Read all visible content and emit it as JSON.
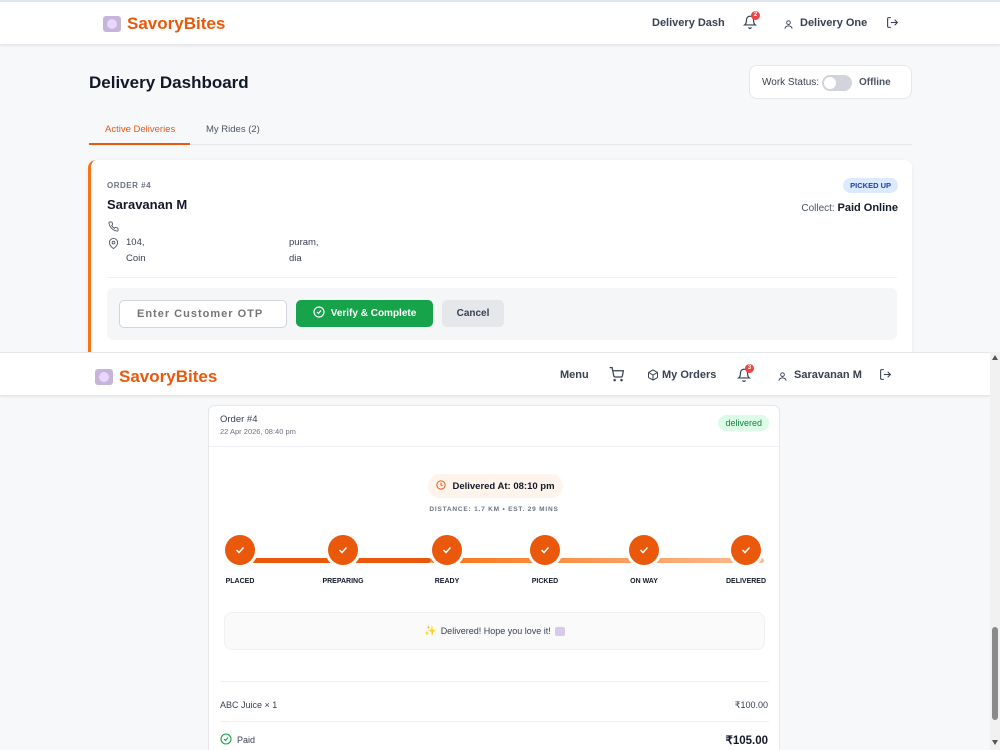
{
  "dashboard": {
    "brand": "SavoryBites",
    "nav": {
      "link": "Delivery Dash",
      "notification_count": "2",
      "user": "Delivery One"
    },
    "title": "Delivery Dashboard",
    "work_status": {
      "label": "Work Status:",
      "value": "Offline"
    },
    "tabs": [
      {
        "label": "Active Deliveries",
        "active": true
      },
      {
        "label": "My Rides (2)",
        "active": false
      }
    ],
    "order": {
      "label": "ORDER #4",
      "customer": "Saravanan M",
      "address_line1_a": "104,",
      "address_line1_b": "puram,",
      "address_line2_a": "Coin",
      "address_line2_b": "dia",
      "status": "PICKED UP",
      "collect_label": "Collect:",
      "collect_value": "Paid Online",
      "otp_placeholder": "Enter Customer OTP",
      "verify_label": "Verify & Complete",
      "cancel_label": "Cancel"
    }
  },
  "customer": {
    "brand": "SavoryBites",
    "nav": {
      "menu": "Menu",
      "orders": "My Orders",
      "notification_count": "3",
      "user": "Saravanan M"
    },
    "order": {
      "title": "Order #4",
      "date": "22 Apr 2026, 08:40 pm",
      "status": "delivered",
      "delivered_at": "Delivered At: 08:10 pm",
      "distance": "DISTANCE: 1.7 KM • EST. 29 MINS",
      "steps": [
        "PLACED",
        "PREPARING",
        "READY",
        "PICKED",
        "ON WAY",
        "DELIVERED"
      ],
      "message": "Delivered! Hope you love it!",
      "item": "ABC Juice × 1",
      "item_price": "₹100.00",
      "payment": "Paid",
      "total": "₹105.00"
    }
  },
  "colors": {
    "brand": "#ea580c",
    "success": "#16a34a",
    "badge": "#ef4444"
  },
  "icons": [
    "logo-icon",
    "bell-icon",
    "user-icon",
    "logout-icon",
    "phone-icon",
    "location-icon",
    "check-circle-icon",
    "cart-icon",
    "box-icon",
    "clock-icon",
    "check-icon",
    "sparkle-icon"
  ]
}
